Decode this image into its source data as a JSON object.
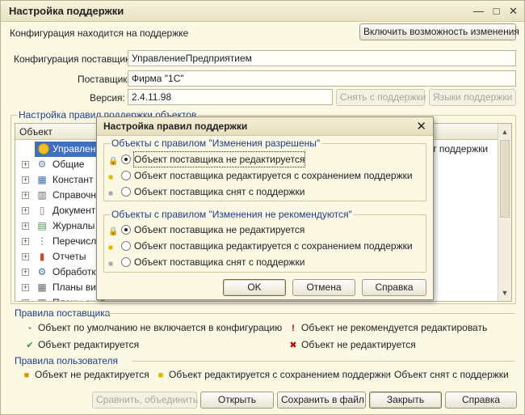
{
  "window": {
    "title": "Настройка поддержки",
    "minimize": "—",
    "restore": "□",
    "close": "✕"
  },
  "header": {
    "status_text": "Конфигурация находится на поддержке",
    "enable_changes_button": "Включить возможность изменения"
  },
  "vendor": {
    "config_label": "Конфигурация поставщика:",
    "config_value": "УправлениеПредприятием",
    "vendor_label": "Поставщик:",
    "vendor_value": "Фирма \"1С\"",
    "version_label": "Версия:",
    "version_value": "2.4.11.98",
    "remove_support_button": "Снять с поддержки",
    "languages_button": "Языки поддержки"
  },
  "rules_section": {
    "title": "Настройка правил поддержки объектов",
    "column_object": "Объект",
    "visible_rule_text": "т поддержки",
    "rows": [
      {
        "label": "УправлениеПр",
        "icon": "circle-config-icon"
      },
      {
        "label": "Общие",
        "icon": "gears-icon"
      },
      {
        "label": "Констант",
        "icon": "constants-icon"
      },
      {
        "label": "Справочн",
        "icon": "catalog-icon"
      },
      {
        "label": "Документ",
        "icon": "document-icon"
      },
      {
        "label": "Журналы д",
        "icon": "journal-icon"
      },
      {
        "label": "Перечисле",
        "icon": "enum-icon"
      },
      {
        "label": "Отчеты",
        "icon": "report-icon"
      },
      {
        "label": "Обработки",
        "icon": "processing-icon"
      },
      {
        "label": "Планы вид",
        "icon": "plan-icon"
      },
      {
        "label": "Планы счет",
        "icon": "plan-accounts-icon"
      }
    ]
  },
  "vendor_rules": {
    "title": "Правила поставщика",
    "items": [
      "Объект по умолчанию не включается в конфигурацию",
      "Объект не рекомендуется редактировать",
      "Объект редактируется",
      "Объект не редактируется"
    ]
  },
  "user_rules": {
    "title": "Правила пользователя",
    "items": [
      "Объект не редактируется",
      "Объект редактируется с сохранением поддержки",
      "Объект снят с поддержки"
    ]
  },
  "footer": {
    "compare_button": "Сравнить, объединить",
    "open_button": "Открыть",
    "save_file_button": "Сохранить в файл",
    "close_button": "Закрыть",
    "help_button": "Справка"
  },
  "dialog": {
    "title": "Настройка правил поддержки",
    "close": "✕",
    "group1_title": "Объекты с правилом \"Изменения разрешены\"",
    "group1_options": [
      "Объект поставщика не редактируется",
      "Объект поставщика редактируется с сохранением поддержки",
      "Объект поставщика снят с поддержки"
    ],
    "group1_selected": 0,
    "group2_title": "Объекты с правилом \"Изменения не рекомендуются\"",
    "group2_options": [
      "Объект поставщика не редактируется",
      "Объект поставщика редактируется с сохранением поддержки",
      "Объект поставщика снят с поддержки"
    ],
    "group2_selected": 0,
    "ok_button": "OK",
    "cancel_button": "Отмена",
    "help_button": "Справка"
  }
}
